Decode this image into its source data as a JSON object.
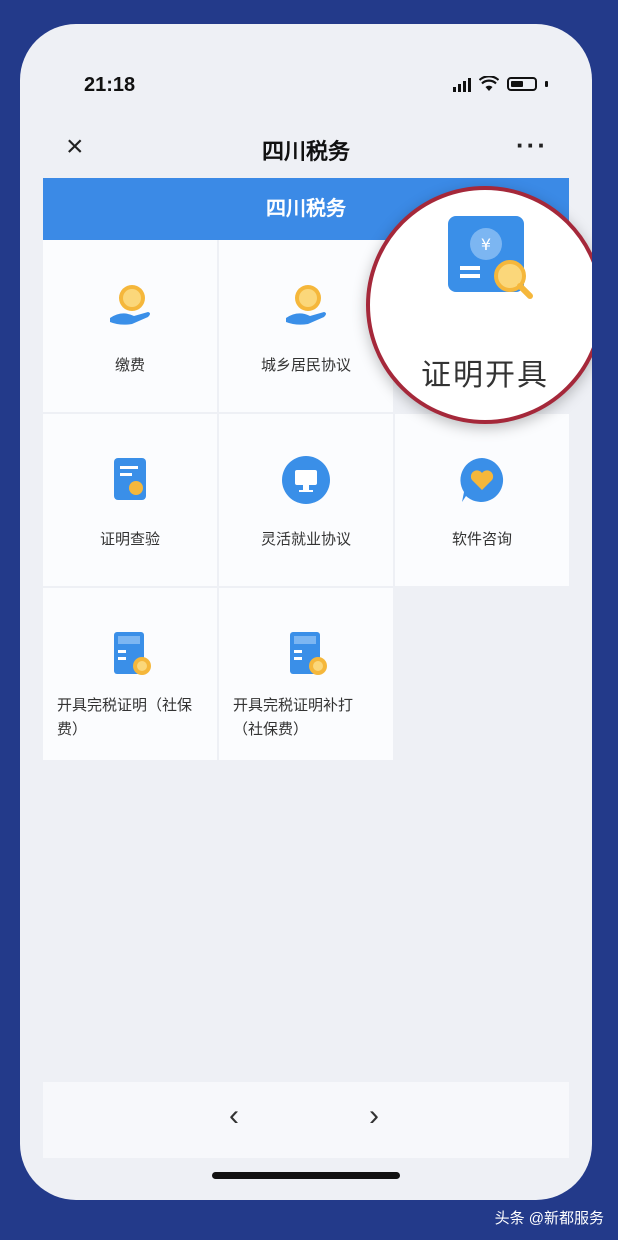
{
  "status": {
    "time": "21:18"
  },
  "nav": {
    "title": "四川税务",
    "close_icon": "×",
    "more_icon": "···"
  },
  "banner": {
    "title": "四川税务"
  },
  "grid": {
    "items": [
      {
        "label": "缴费",
        "icon": "coin-hand-icon"
      },
      {
        "label": "城乡居民协议",
        "icon": "coin-hand-icon"
      },
      {
        "label": "证明查验",
        "icon": "document-stamp-icon"
      },
      {
        "label": "灵活就业协议",
        "icon": "monitor-icon"
      },
      {
        "label": "软件咨询",
        "icon": "heart-chat-icon"
      },
      {
        "label": "开具完税证明（社保费）",
        "icon": "tax-certificate-icon"
      },
      {
        "label": "开具完税证明补打（社保费）",
        "icon": "tax-certificate-icon"
      }
    ]
  },
  "zoom": {
    "label": "证明开具",
    "icon": "certificate-search-icon"
  },
  "bottom": {
    "back": "‹",
    "forward": "›"
  },
  "watermark": "头条 @新都服务",
  "colors": {
    "banner": "#3b8ae6",
    "background": "#233a8a",
    "highlight_ring": "#a5283a"
  }
}
